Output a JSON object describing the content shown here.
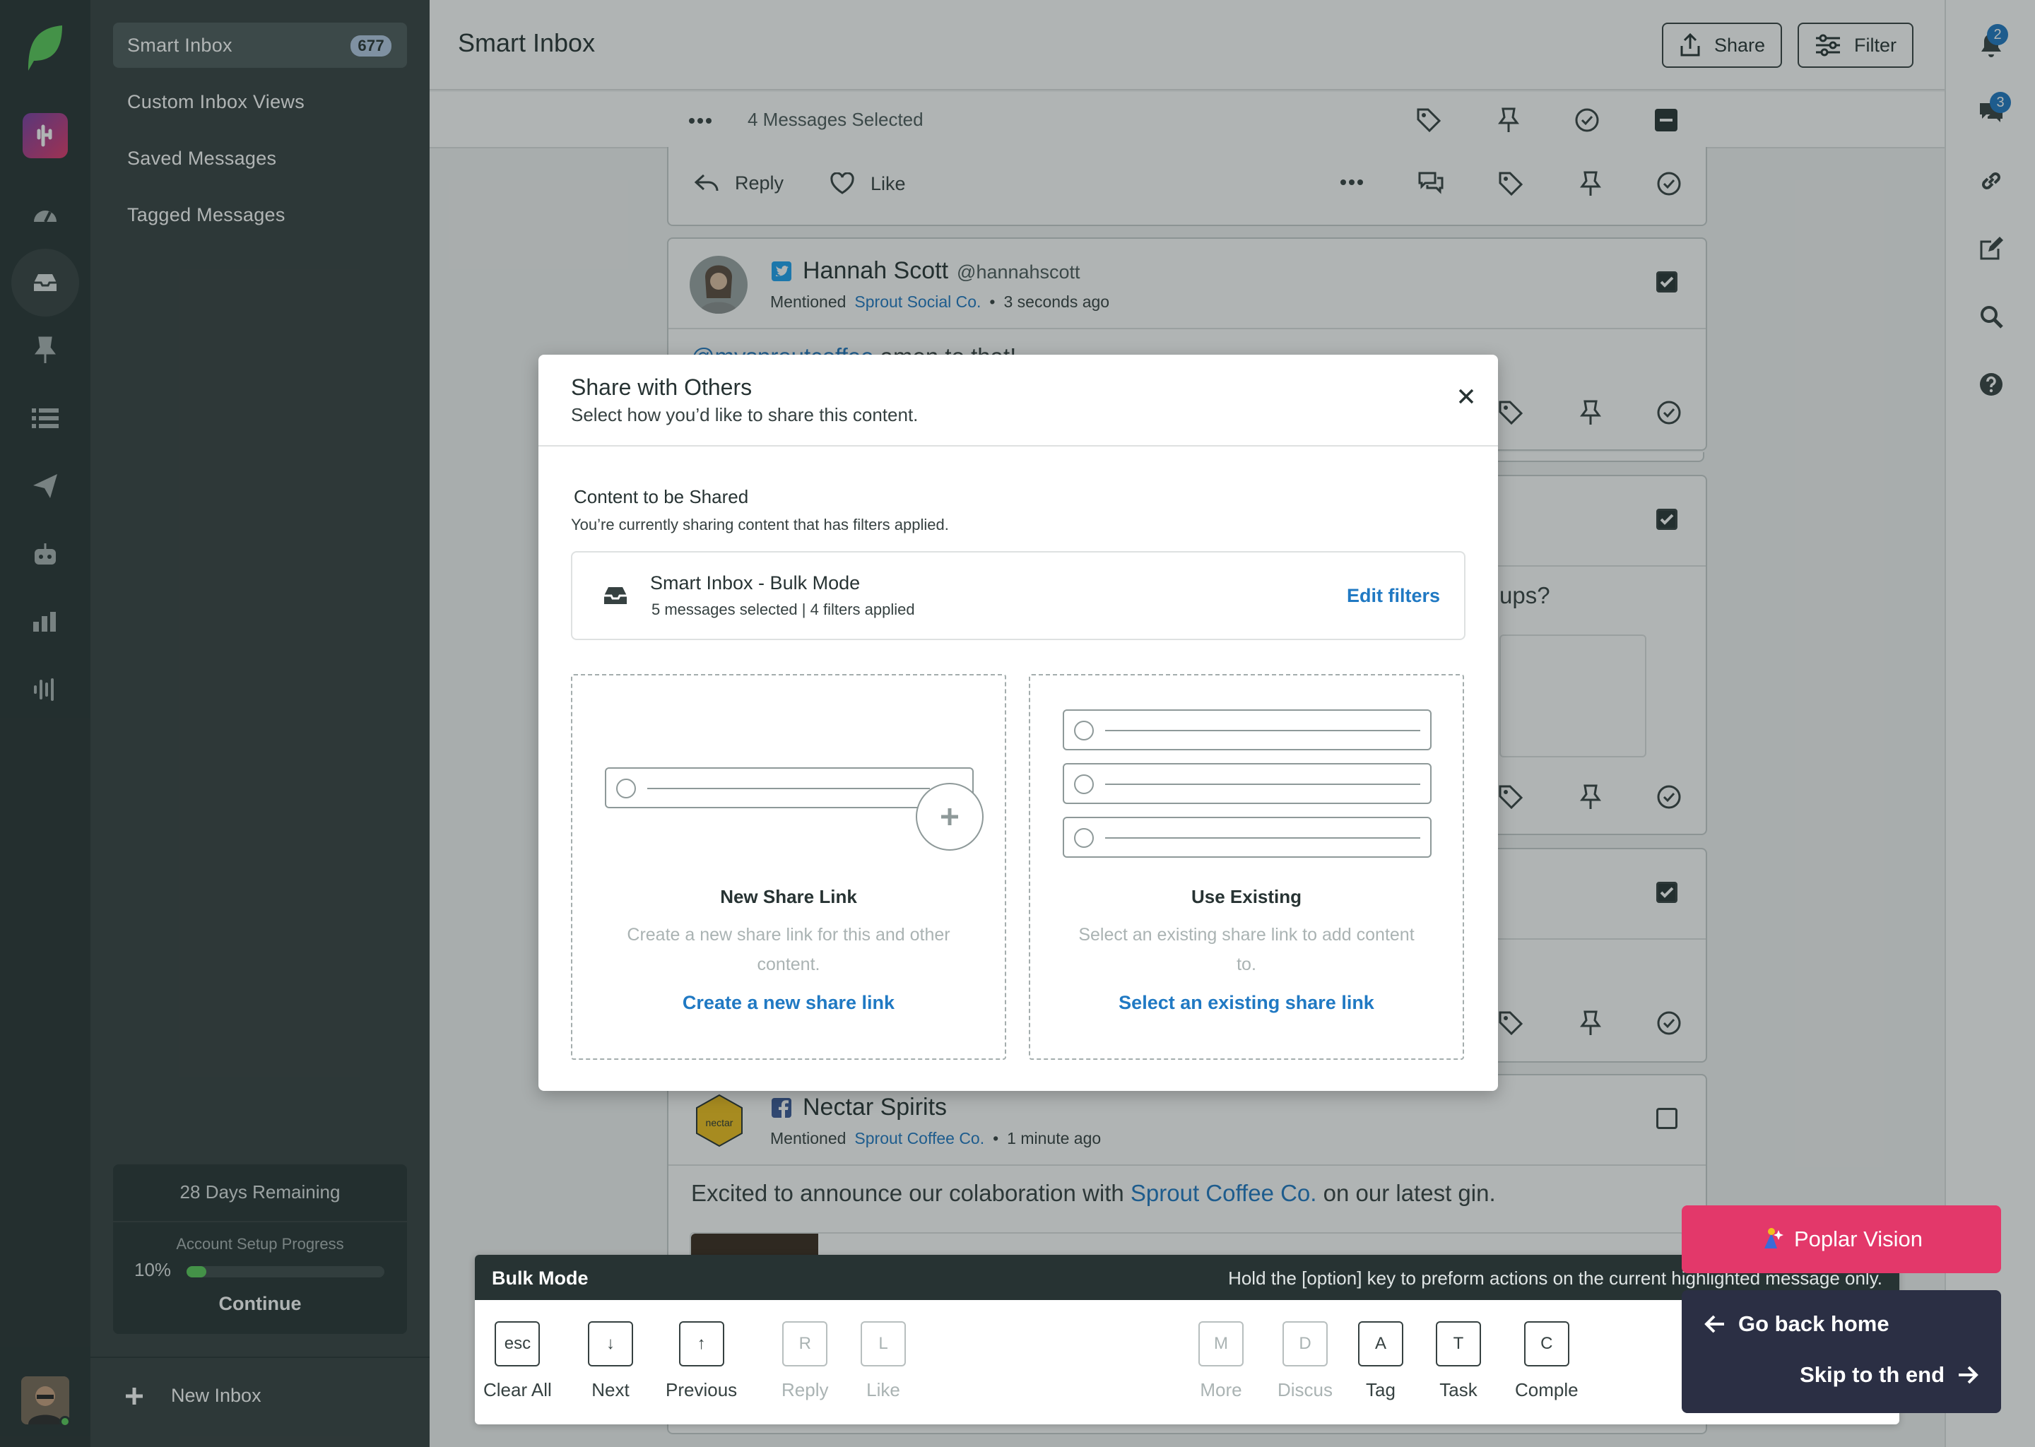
{
  "nav": {
    "items": [
      {
        "label": "Smart Inbox",
        "count": "677"
      },
      {
        "label": "Custom Inbox Views"
      },
      {
        "label": "Saved Messages"
      },
      {
        "label": "Tagged Messages"
      }
    ],
    "trial": {
      "days": "28 Days Remaining",
      "progress_label": "Account Setup Progress",
      "progress_text": "10%",
      "progress_value": 0.1,
      "continue": "Continue"
    },
    "new_inbox": "New Inbox"
  },
  "header": {
    "title": "Smart Inbox",
    "share": "Share",
    "filter": "Filter"
  },
  "selection": {
    "text": "4 Messages Selected"
  },
  "notifications": {
    "bell": "2",
    "messages": "3"
  },
  "messages": {
    "reply": "Reply",
    "like": "Like",
    "m1": {
      "name": "Hannah Scott",
      "handle": "@hannahscott",
      "mentioned": "Mentioned",
      "profile": "Sprout Social Co.",
      "time": "3 seconds ago",
      "text_link": "@mysproutcoffee",
      "text": " amen to that!"
    },
    "m2": {
      "text_end": "ups?"
    },
    "m3": {
      "name": "Nectar Spirits",
      "mentioned": "Mentioned",
      "profile": "Sprout Coffee Co.",
      "time": "1 minute ago",
      "text_a": "Excited to announce our colaboration with ",
      "text_link": "Sprout Coffee Co.",
      "text_b": " on our latest gin.",
      "logo_text": "nectar"
    }
  },
  "modal": {
    "title": "Share with Others",
    "subtitle": "Select how you’d like to share this content.",
    "section_title": "Content to be Shared",
    "section_sub": "You’re currently sharing content that has filters applied.",
    "inbox_name": "Smart Inbox - Bulk Mode",
    "inbox_meta": "5 messages selected | 4 filters applied",
    "edit_filters": "Edit filters",
    "new": {
      "title": "New Share Link",
      "desc": "Create a new share link for this and other content.",
      "link": "Create a new share link"
    },
    "existing": {
      "title": "Use Existing",
      "desc": "Select an existing share link to add content to.",
      "link": "Select an existing share link"
    }
  },
  "bulk": {
    "title": "Bulk Mode",
    "hint": "Hold the [option] key to preform actions on the current highlighted message only.",
    "keys": [
      {
        "key": "esc",
        "label": "Clear All",
        "enabled": true
      },
      {
        "key": "↓",
        "label": "Next",
        "enabled": true
      },
      {
        "key": "↑",
        "label": "Previous",
        "enabled": true
      },
      {
        "key": "R",
        "label": "Reply",
        "enabled": false
      },
      {
        "key": "L",
        "label": "Like",
        "enabled": false
      },
      {
        "key": "M",
        "label": "More",
        "enabled": false
      },
      {
        "key": "D",
        "label": "Discus",
        "enabled": false
      },
      {
        "key": "A",
        "label": "Tag",
        "enabled": true
      },
      {
        "key": "T",
        "label": "Task",
        "enabled": true
      },
      {
        "key": "C",
        "label": "Comple",
        "enabled": true
      }
    ]
  },
  "popular_vision": {
    "label": "Poplar Vision"
  },
  "nav_box": {
    "back": "Go back home",
    "skip": "Skip to th end"
  },
  "colors": {
    "sidebar_dark": "#273333",
    "sidebar": "#364141",
    "link": "#2079c3",
    "brand_green": "#59cb59",
    "popular_vision": "#e3386a",
    "nav_box": "#2b2f44"
  }
}
